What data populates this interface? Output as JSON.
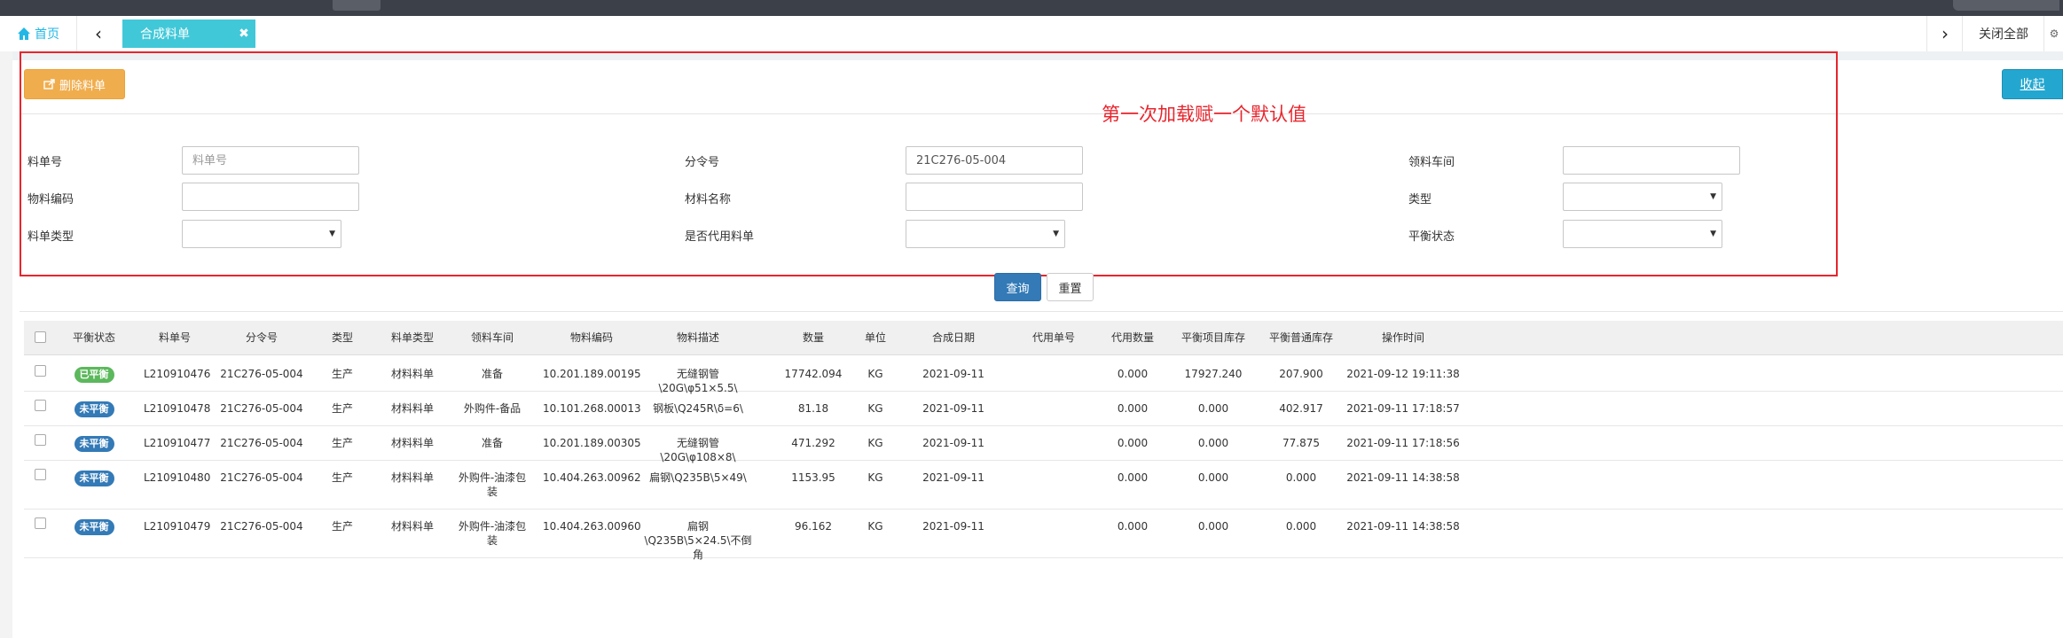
{
  "tabs": {
    "home_label": "首页",
    "active_label": "合成料单",
    "close_all_label": "关闭全部"
  },
  "toolbar": {
    "delete_label": "删除料单",
    "collapse_label": "收起"
  },
  "annotation_text": "第一次加载赋一个默认值",
  "form": {
    "order_no": {
      "label": "料单号",
      "placeholder": "料单号",
      "value": ""
    },
    "sub_order": {
      "label": "分令号",
      "value": "21C276-05-004"
    },
    "workshop": {
      "label": "领料车间",
      "value": ""
    },
    "material_code": {
      "label": "物料编码",
      "value": ""
    },
    "material_name": {
      "label": "材料名称",
      "value": ""
    },
    "type": {
      "label": "类型"
    },
    "order_type": {
      "label": "料单类型"
    },
    "substitute": {
      "label": "是否代用料单"
    },
    "balance_status": {
      "label": "平衡状态"
    },
    "query_label": "查询",
    "reset_label": "重置"
  },
  "table": {
    "columns": [
      "平衡状态",
      "料单号",
      "分令号",
      "类型",
      "料单类型",
      "领料车间",
      "物料编码",
      "物料描述",
      "数量",
      "单位",
      "合成日期",
      "代用单号",
      "代用数量",
      "平衡项目库存",
      "平衡普通库存",
      "操作时间"
    ],
    "rows": [
      {
        "status": "已平衡",
        "status_color": "#5cb85c",
        "cells": [
          "L210910476",
          "21C276-05-004",
          "生产",
          "材料料单",
          "准备",
          "10.201.189.00195",
          "无缝钢管\\20G\\φ51×5.5\\",
          "17742.094",
          "KG",
          "2021-09-11",
          "",
          "0.000",
          "17927.240",
          "207.900",
          "2021-09-12 19:11:38"
        ]
      },
      {
        "status": "未平衡",
        "status_color": "#337ab7",
        "cells": [
          "L210910478",
          "21C276-05-004",
          "生产",
          "材料料单",
          "外购件-备品",
          "10.101.268.00013",
          "钢板\\Q245R\\δ=6\\",
          "81.18",
          "KG",
          "2021-09-11",
          "",
          "0.000",
          "0.000",
          "402.917",
          "2021-09-11 17:18:57"
        ]
      },
      {
        "status": "未平衡",
        "status_color": "#337ab7",
        "cells": [
          "L210910477",
          "21C276-05-004",
          "生产",
          "材料料单",
          "准备",
          "10.201.189.00305",
          "无缝钢管\\20G\\φ108×8\\",
          "471.292",
          "KG",
          "2021-09-11",
          "",
          "0.000",
          "0.000",
          "77.875",
          "2021-09-11 17:18:56"
        ]
      },
      {
        "status": "未平衡",
        "status_color": "#337ab7",
        "cells": [
          "L210910480",
          "21C276-05-004",
          "生产",
          "材料料单",
          "外购件-油漆包装",
          "10.404.263.00962",
          "扁钢\\Q235B\\5×49\\",
          "1153.95",
          "KG",
          "2021-09-11",
          "",
          "0.000",
          "0.000",
          "0.000",
          "2021-09-11 14:38:58"
        ]
      },
      {
        "status": "未平衡",
        "status_color": "#337ab7",
        "cells": [
          "L210910479",
          "21C276-05-004",
          "生产",
          "材料料单",
          "外购件-油漆包装",
          "10.404.263.00960",
          "扁钢\\Q235B\\5×24.5\\不倒角",
          "96.162",
          "KG",
          "2021-09-11",
          "",
          "0.000",
          "0.000",
          "0.000",
          "2021-09-11 14:38:58"
        ]
      }
    ]
  }
}
